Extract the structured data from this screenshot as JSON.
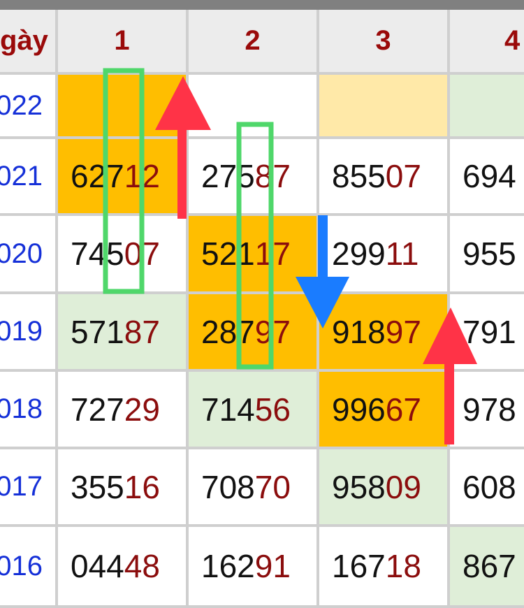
{
  "table": {
    "header": [
      "gày",
      "1",
      "2",
      "3",
      "4"
    ],
    "rows": [
      {
        "date": "022",
        "cells": [
          {
            "head": "",
            "tail": "",
            "bg": "orange"
          },
          {
            "head": "",
            "tail": "",
            "bg": "white"
          },
          {
            "head": "",
            "tail": "",
            "bg": "pale"
          },
          {
            "head": "",
            "tail": "",
            "bg": "green"
          }
        ]
      },
      {
        "date": "021",
        "cells": [
          {
            "head": "627",
            "tail": "12",
            "bg": "orange"
          },
          {
            "head": "275",
            "tail": "87",
            "bg": "white"
          },
          {
            "head": "855",
            "tail": "07",
            "bg": "white"
          },
          {
            "head": "694",
            "tail": "",
            "bg": "white"
          }
        ]
      },
      {
        "date": "020",
        "cells": [
          {
            "head": "745",
            "tail": "07",
            "bg": "white"
          },
          {
            "head": "521",
            "tail": "17",
            "bg": "orange"
          },
          {
            "head": "299",
            "tail": "11",
            "bg": "white"
          },
          {
            "head": "955",
            "tail": "",
            "bg": "white"
          }
        ]
      },
      {
        "date": "019",
        "cells": [
          {
            "head": "571",
            "tail": "87",
            "bg": "green"
          },
          {
            "head": "287",
            "tail": "97",
            "bg": "orange"
          },
          {
            "head": "918",
            "tail": "97",
            "bg": "orange"
          },
          {
            "head": "791",
            "tail": "",
            "bg": "white"
          }
        ]
      },
      {
        "date": "018",
        "cells": [
          {
            "head": "727",
            "tail": "29",
            "bg": "white"
          },
          {
            "head": "714",
            "tail": "56",
            "bg": "green"
          },
          {
            "head": "996",
            "tail": "67",
            "bg": "orange"
          },
          {
            "head": "978",
            "tail": "",
            "bg": "white"
          }
        ]
      },
      {
        "date": "017",
        "cells": [
          {
            "head": "355",
            "tail": "16",
            "bg": "white"
          },
          {
            "head": "708",
            "tail": "70",
            "bg": "white"
          },
          {
            "head": "958",
            "tail": "09",
            "bg": "green"
          },
          {
            "head": "608",
            "tail": "",
            "bg": "white"
          }
        ]
      },
      {
        "date": "016",
        "cells": [
          {
            "head": "044",
            "tail": "48",
            "bg": "white"
          },
          {
            "head": "162",
            "tail": "91",
            "bg": "white"
          },
          {
            "head": "167",
            "tail": "18",
            "bg": "white"
          },
          {
            "head": "867",
            "tail": "",
            "bg": "green"
          }
        ]
      }
    ]
  },
  "annotations": {
    "boxes": [
      {
        "color": "#4fd76a"
      },
      {
        "color": "#4fd76a"
      }
    ],
    "arrows": [
      {
        "direction": "up",
        "color": "#ff3347"
      },
      {
        "direction": "down",
        "color": "#1a7cff"
      },
      {
        "direction": "up",
        "color": "#ff3347"
      }
    ]
  }
}
